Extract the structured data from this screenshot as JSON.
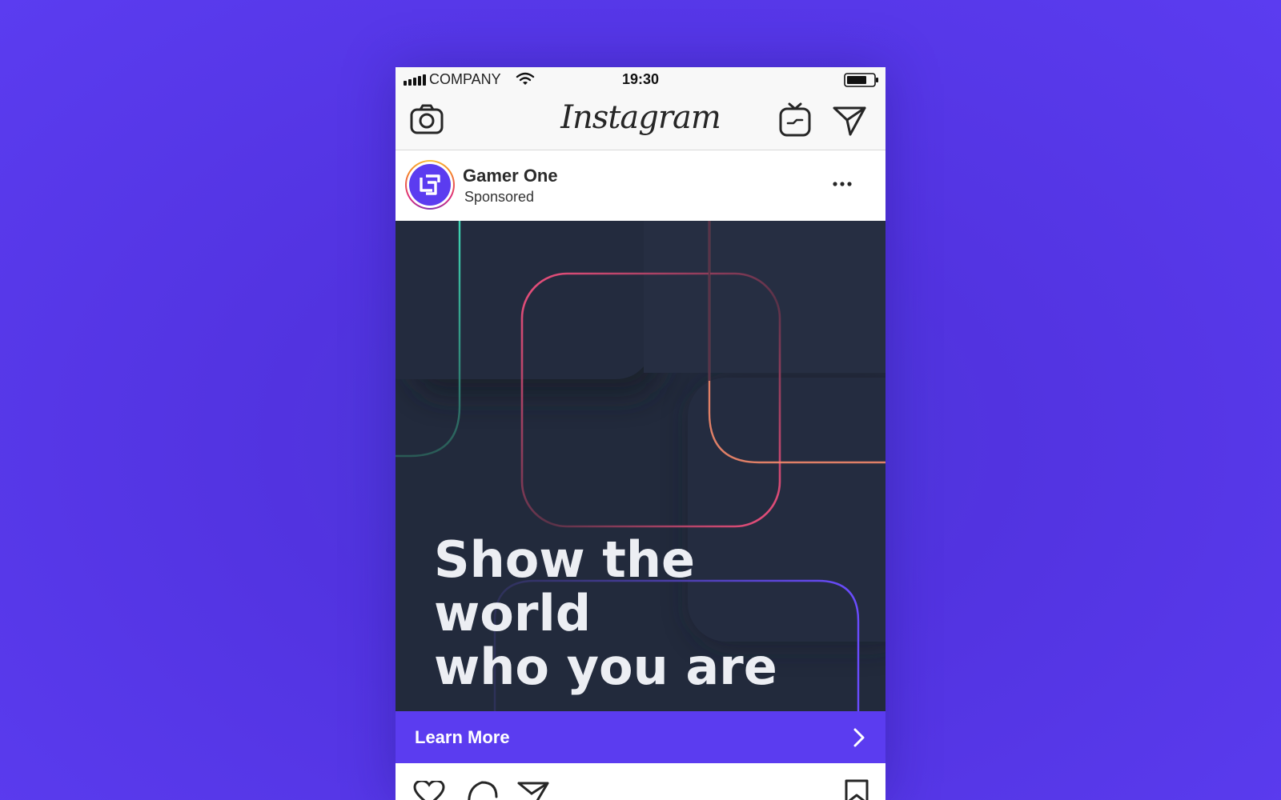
{
  "status_bar": {
    "carrier": "COMPANY",
    "time": "19:30"
  },
  "header": {
    "logo_text": "Instagram",
    "icons": [
      "camera-icon",
      "igtv-icon",
      "direct-message-icon"
    ]
  },
  "post": {
    "account_name": "Gamer One",
    "label": "Sponsored",
    "headline": [
      "Show the world",
      "who you are"
    ],
    "cta_label": "Learn More",
    "action_icons": [
      "heart-icon",
      "comment-icon",
      "share-icon",
      "bookmark-icon"
    ]
  },
  "colors": {
    "background": "#5b3cf0",
    "accent": "#5b3cf0",
    "post_bg": "#222a3c",
    "teal_line": "#3fd6b4",
    "pink_line": "#f0507e",
    "orange_line": "#f58a6b",
    "purple_line": "#6a4cff"
  }
}
